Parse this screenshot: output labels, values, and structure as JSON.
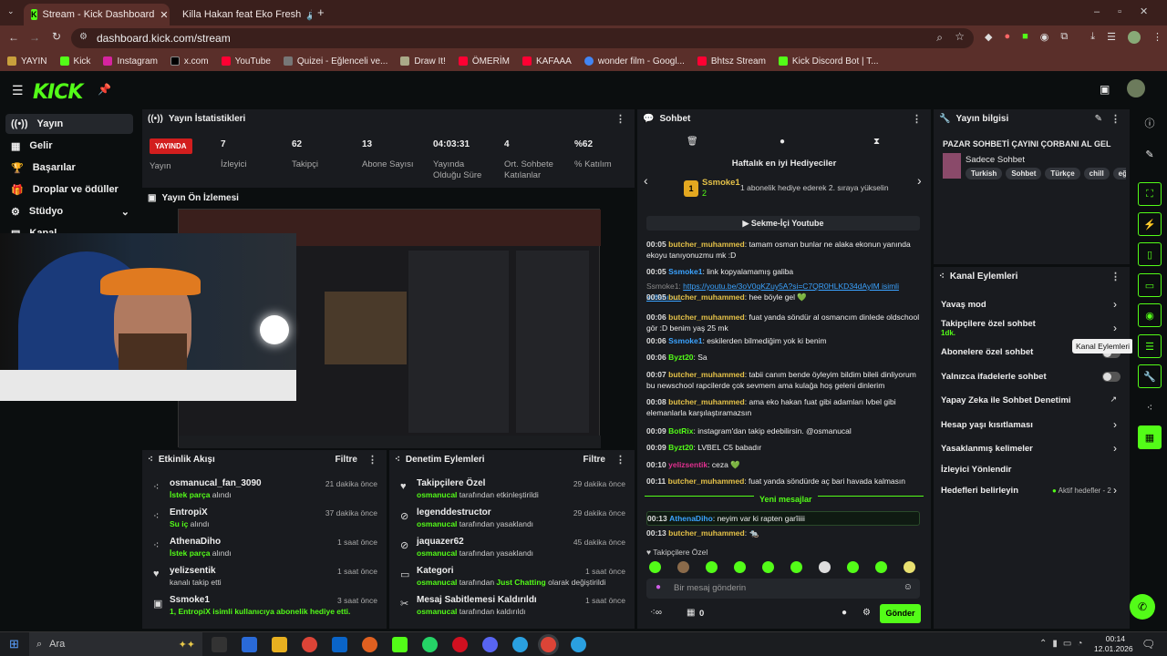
{
  "browser": {
    "tabs": [
      {
        "title": "Stream - Kick Dashboard",
        "active": true
      },
      {
        "title": "Killa Hakan feat Eko Fresh",
        "active": false
      }
    ],
    "url": "dashboard.kick.com/stream",
    "bookmarks": [
      "YAYIN",
      "Kick",
      "Instagram",
      "x.com",
      "YouTube",
      "Quizei - Eğlenceli ve...",
      "Draw It!",
      "ÖMERİM",
      "KAFAAA",
      "wonder film - Googl...",
      "Bhtsz Stream",
      "Kick Discord Bot | T..."
    ]
  },
  "kick": {
    "logo": "KICK",
    "sidebar": [
      {
        "label": "Yayın",
        "active": true
      },
      {
        "label": "Gelir"
      },
      {
        "label": "Başarılar"
      },
      {
        "label": "Droplar ve ödüller"
      },
      {
        "label": "Stüdyo"
      },
      {
        "label": "Kanal"
      }
    ]
  },
  "stats": {
    "title": "Yayın İstatistikleri",
    "live": "YAYINDA",
    "live_label": "Yayın",
    "items": [
      {
        "value": "7",
        "label": "İzleyici"
      },
      {
        "value": "62",
        "label": "Takipçi"
      },
      {
        "value": "13",
        "label": "Abone Sayısı"
      },
      {
        "value": "04:03:31",
        "label": "Yayında Olduğu Süre"
      },
      {
        "value": "4",
        "label": "Ort. Sohbete Katılanlar"
      },
      {
        "value": "%62",
        "label": "% Katılım"
      }
    ]
  },
  "preview": {
    "title": "Yayın Ön İzlemesi"
  },
  "activity": {
    "title": "Etkinlik Akışı",
    "filter": "Filtre",
    "rows": [
      {
        "name": "osmanucal_fan_3090",
        "sub_green": "İstek parça",
        "sub": " alındı",
        "time": "21 dakika önce"
      },
      {
        "name": "EntropiX",
        "sub_green": "Su iç",
        "sub": " alındı",
        "time": "37 dakika önce"
      },
      {
        "name": "AthenaDiho",
        "sub_green": "İstek parça",
        "sub": " alındı",
        "time": "1 saat önce"
      },
      {
        "name": "yelizsentik",
        "sub_green": "",
        "sub": "kanalı takip etti",
        "time": "1 saat önce"
      },
      {
        "name": "Ssmoke1",
        "sub_green": "1, EntropiX",
        "sub": " isimli kullanıcıya abonelik hediye etti.",
        "time": "3 saat önce"
      }
    ]
  },
  "moderation": {
    "title": "Denetim Eylemleri",
    "filter": "Filtre",
    "rows": [
      {
        "name": "Takipçilere Özel",
        "user": "osmanucal",
        "sub": " tarafından etkinleştirildi",
        "time": "29 dakika önce"
      },
      {
        "name": "legenddestructor",
        "user": "osmanucal",
        "sub": " tarafından yasaklandı",
        "time": "29 dakika önce"
      },
      {
        "name": "jaquazer62",
        "user": "osmanucal",
        "sub": " tarafından yasaklandı",
        "time": "45 dakika önce"
      },
      {
        "name": "Kategori",
        "user": "osmanucal",
        "sub": " tarafından ",
        "extra": "Just Chatting",
        "sub2": " olarak değiştirildi",
        "time": "1 saat önce"
      },
      {
        "name": "Mesaj Sabitlemesi Kaldırıldı",
        "user": "osmanucal",
        "sub": " tarafından kaldırıldı",
        "time": "1 saat önce"
      }
    ]
  },
  "chat": {
    "title": "Sohbet",
    "gifters_title": "Haftalık en iyi Hediyeciler",
    "top_gifter": "Ssmoke1",
    "top_gifter_count": "2",
    "top_gifter_rank": "1",
    "gift_hint": "1 abonelik hediye ederek 2. sıraya yükselin",
    "pinned": "Sekme-İçi Youtube",
    "new_messages": "Yeni mesajlar",
    "follower_only": "Takipçilere Özel",
    "input_placeholder": "Bir mesaj gönderin",
    "send": "Gönder",
    "footer_count": "0",
    "messages": [
      {
        "ts": "00:05",
        "user": "butcher_muhammed",
        "cls": "u1",
        "text": "tamam osman bunlar ne alaka ekonun yanında ekoyu tanıyonuzmu mk :D"
      },
      {
        "ts": "00:05",
        "user": "Ssmoke1",
        "cls": "u2",
        "text": "link kopyalamamış galiba"
      },
      {
        "ts": "",
        "user": "Ssmoke1:",
        "cls": "",
        "text": "https://youtu.be/3oV0qKZuy5A?si=C7QR0HLKD34dAyIM isimli kullanıcı..."
      },
      {
        "ts": "00:05",
        "user": "butcher_muhammed",
        "cls": "u1",
        "text": "hee böyle gel 💚"
      },
      {
        "ts": "00:06",
        "user": "butcher_muhammed",
        "cls": "u1",
        "text": "fuat yanda söndür al osmancım dinlede oldschool gör :D benim yaş 25 mk"
      },
      {
        "ts": "00:06",
        "user": "Ssmoke1",
        "cls": "u2",
        "text": "eskilerden bilmediğim yok ki benim"
      },
      {
        "ts": "00:06",
        "user": "Byzt20",
        "cls": "u3",
        "text": "Sa"
      },
      {
        "ts": "00:07",
        "user": "butcher_muhammed",
        "cls": "u1",
        "text": "tabii canım bende öyleyim bildim bileli dinliyorum bu newschool rapcilerde çok sevmem ama kulağa hoş geleni dinlerim"
      },
      {
        "ts": "00:08",
        "user": "butcher_muhammed",
        "cls": "u1",
        "text": "ama eko hakan fuat gibi adamları lvbel gibi elemanlarla karşılaştıramazsın"
      },
      {
        "ts": "00:09",
        "user": "BotRix",
        "cls": "u3",
        "text": "instagram'dan takip edebilirsin. @osmanucal"
      },
      {
        "ts": "00:09",
        "user": "Byzt20",
        "cls": "u3",
        "text": "LVBEL C5 babadır"
      },
      {
        "ts": "00:10",
        "user": "yelizsentik",
        "cls": "u4",
        "text": "ceza 💚"
      },
      {
        "ts": "00:11",
        "user": "butcher_muhammed",
        "cls": "u1",
        "text": "fuat yanda söndürde aç bari havada kalmasın"
      },
      {
        "ts": "00:13",
        "user": "AthenaDiho",
        "cls": "u2",
        "text": "neyim var ki rapten garîiiii"
      },
      {
        "ts": "00:13",
        "user": "butcher_muhammed",
        "cls": "u1",
        "text": "🐀"
      }
    ]
  },
  "info": {
    "title": "Yayın bilgisi",
    "stream_title": "PAZAR SOHBETİ ÇAYINI ÇORBANI AL GEL",
    "category": "Sadece Sohbet",
    "tags": [
      "Turkish",
      "Sohbet",
      "Türkçe",
      "chill",
      "eğlen"
    ]
  },
  "channel": {
    "title": "Kanal Eylemleri",
    "tooltip": "Kanal Eylemleri",
    "rows": [
      {
        "label": "Yavaş mod",
        "kind": "chev"
      },
      {
        "label": "Takipçilere özel sohbet",
        "sub": "1dk.",
        "kind": "chev"
      },
      {
        "label": "Abonelere özel sohbet",
        "kind": "toggle"
      },
      {
        "label": "Yalnızca ifadelerle sohbet",
        "kind": "toggle"
      },
      {
        "label": "Yapay Zeka ile Sohbet Denetimi",
        "kind": "ext"
      },
      {
        "label": "Hesap yaşı kısıtlaması",
        "kind": "chev"
      },
      {
        "label": "Yasaklanmış kelimeler",
        "kind": "chev"
      },
      {
        "label": "İzleyici Yönlendir",
        "kind": "none"
      },
      {
        "label": "Hedefleri belirleyin",
        "extra": "Aktif hedefler - 2",
        "kind": "chev"
      }
    ]
  },
  "taskbar": {
    "search": "Ara",
    "time": "00:14",
    "date": "12.01.2026"
  },
  "colors": {
    "accent": "#53fc18",
    "panel": "#191b1f",
    "live": "#d21e1e"
  }
}
